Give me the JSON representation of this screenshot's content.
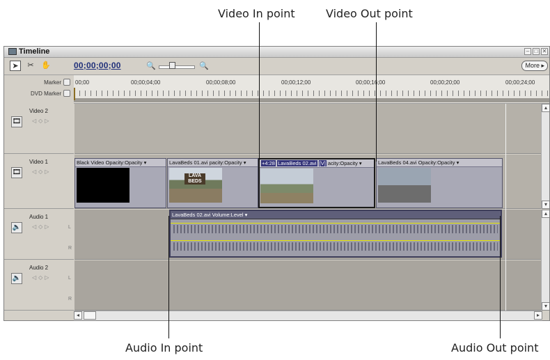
{
  "callouts": {
    "video_in": "Video In point",
    "video_out": "Video Out point",
    "audio_in": "Audio In point",
    "audio_out": "Audio Out point"
  },
  "window": {
    "title": "Timeline",
    "controls": {
      "minimize": "–",
      "maximize": "□",
      "close": "✕"
    }
  },
  "toolbar": {
    "timecode": "00;00;00;00",
    "more_label": "More ▸",
    "icons": [
      "selection-tool",
      "razor-tool",
      "hand-tool",
      "zoom-out",
      "zoom-in"
    ]
  },
  "ruler": {
    "marker_label": "Marker",
    "dvd_marker_label": "DVD Marker",
    "ticks": [
      "00;00",
      "00;00;04;00",
      "00;00;08;00",
      "00;00;12;00",
      "00;00;16;00",
      "00;00;20;00",
      "00;00;24;00"
    ]
  },
  "tracks": {
    "video2": {
      "name": "Video 2"
    },
    "video1": {
      "name": "Video 1"
    },
    "audio1": {
      "name": "Audio 1",
      "l": "L",
      "r": "R"
    },
    "audio2": {
      "name": "Audio 2",
      "l": "L",
      "r": "R"
    }
  },
  "clips": {
    "black_video": {
      "name": "Black Video",
      "fx": "Opacity:Opacity ▾"
    },
    "lavabeds01": {
      "name": "LavaBeds 01.avi",
      "fx": "pacity:Opacity ▾",
      "thumb_text": "LAVA BEDS"
    },
    "lavabeds02": {
      "offset": "+4:28",
      "name": "LavaBeds 02.avi",
      "tag": "[V]",
      "fx": "acity:Opacity ▾"
    },
    "lavabeds04": {
      "name": "LavaBeds 04.avi",
      "fx": "Opacity:Opacity ▾"
    },
    "audio_clip": {
      "name": "LavaBeds 02.avi",
      "fx": "Volume:Level ▾"
    }
  },
  "colors": {
    "window_bg": "#d4d0c8",
    "timecode": "#20307a",
    "track_lane": "#b5b1a9",
    "volume_line": "#e7e700"
  }
}
